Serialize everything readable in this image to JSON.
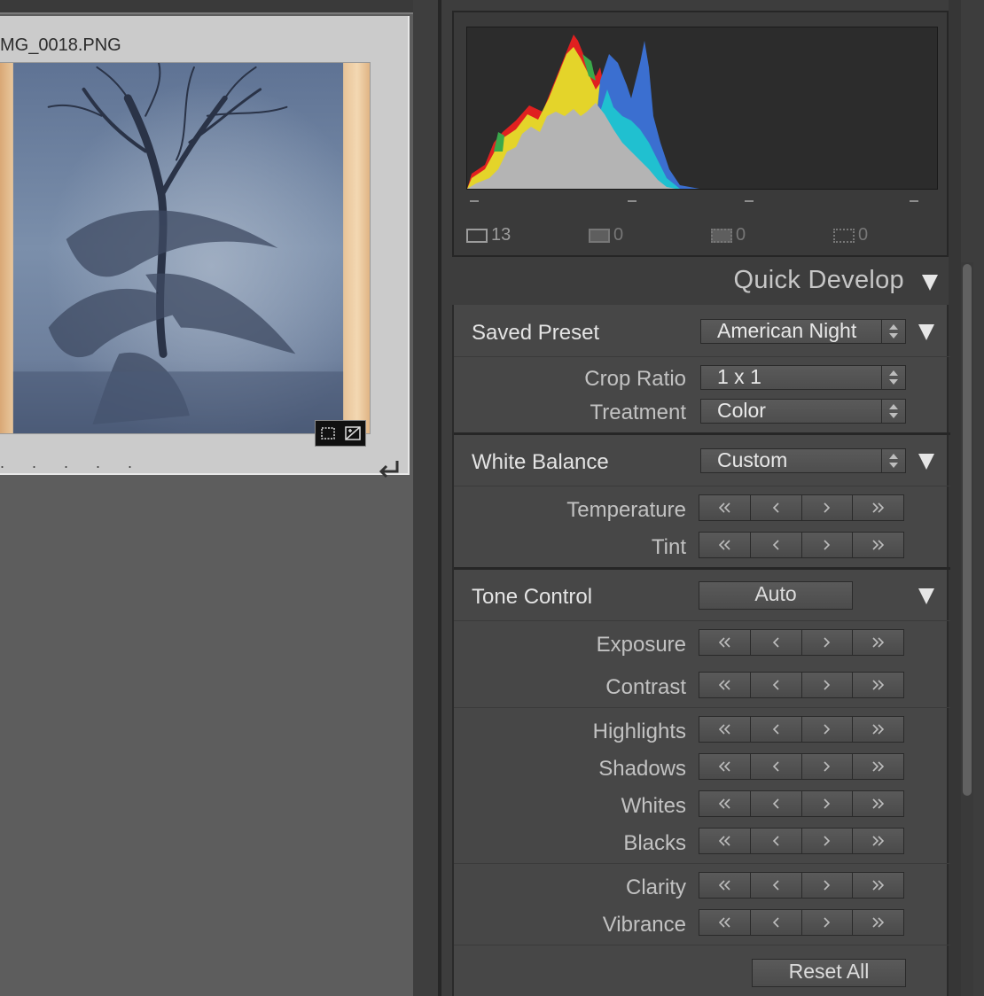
{
  "thumbnail": {
    "filename": "MG_0018.PNG",
    "dots": ". . . . .",
    "badge_icons": [
      "crop-badge-icon",
      "exposure-badge-icon"
    ]
  },
  "histogram": {
    "info": {
      "original_count": "13",
      "virtual_count": "0",
      "rejected_count": "0",
      "missing_count": "0"
    }
  },
  "quick_develop": {
    "title": "Quick Develop",
    "saved_preset": {
      "label": "Saved Preset",
      "value": "American Night"
    },
    "crop_ratio": {
      "label": "Crop Ratio",
      "value": "1 x 1"
    },
    "treatment": {
      "label": "Treatment",
      "value": "Color"
    },
    "white_balance": {
      "label": "White Balance",
      "value": "Custom",
      "rows": [
        "Temperature",
        "Tint"
      ]
    },
    "tone_control": {
      "label": "Tone Control",
      "auto_label": "Auto",
      "rows": [
        "Exposure",
        "Contrast",
        "Highlights",
        "Shadows",
        "Whites",
        "Blacks",
        "Clarity",
        "Vibrance"
      ]
    },
    "reset_label": "Reset All"
  },
  "colors": {
    "panel_bg": "#474747",
    "histogram_red": "#e02020",
    "histogram_yellow": "#e4d42a",
    "histogram_green": "#3aa84a",
    "histogram_cyan": "#20c0d0",
    "histogram_blue": "#3b6fd0",
    "histogram_gray": "#b4b4b4"
  }
}
